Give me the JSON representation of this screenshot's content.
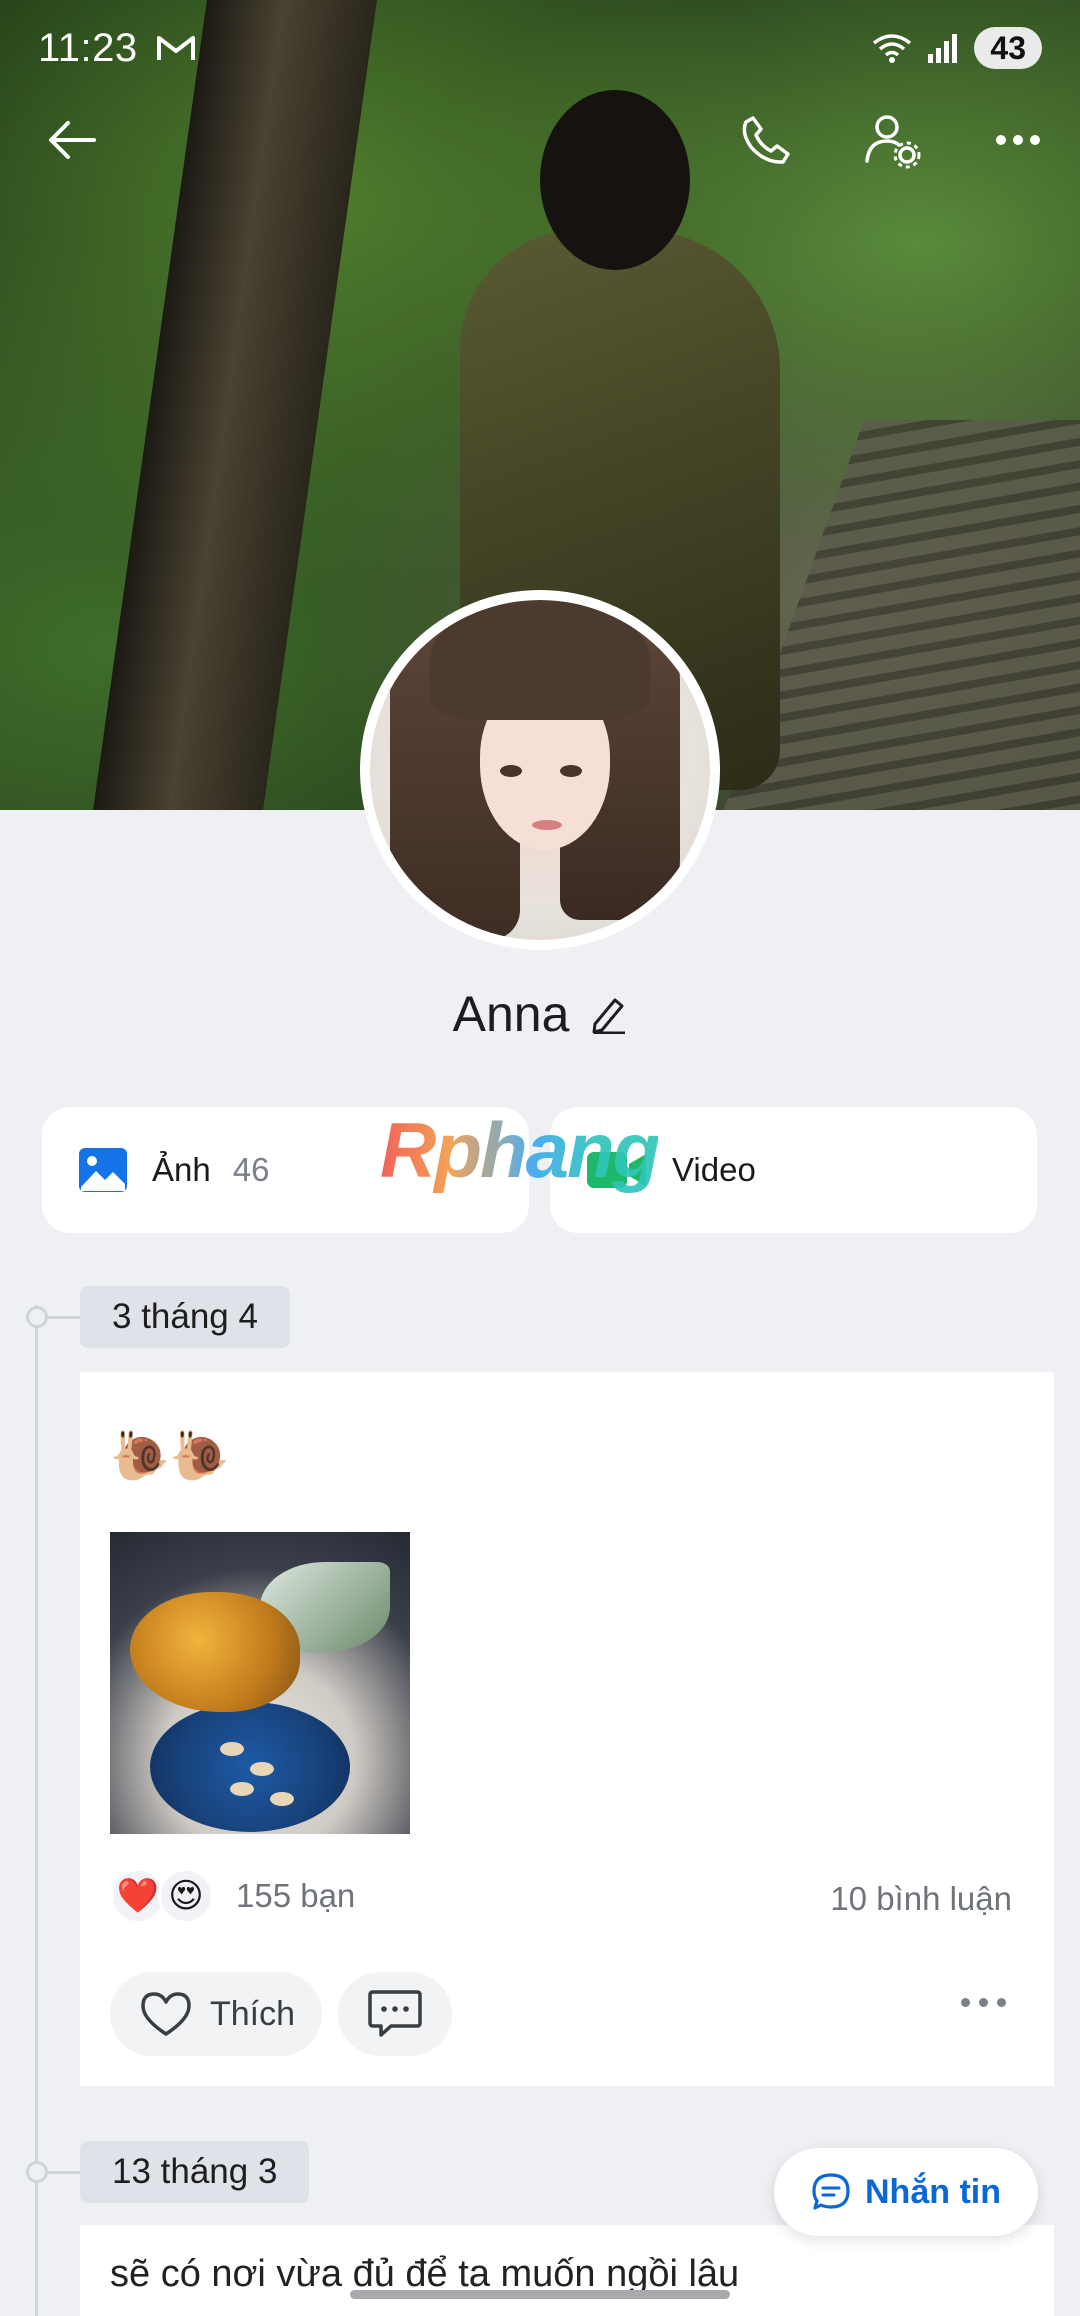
{
  "status_bar": {
    "time": "11:23",
    "battery": "43"
  },
  "profile": {
    "name": "Anna"
  },
  "media": {
    "photos": {
      "label": "Ảnh",
      "count": "46"
    },
    "videos": {
      "label": "Video"
    }
  },
  "watermark": "Rphang",
  "timeline": [
    {
      "date": "3 tháng 4",
      "text": "🐌🐌",
      "reactions": [
        "❤️",
        "😍"
      ],
      "likes_text": "155 bạn",
      "comments_text": "10 bình luận",
      "like_label": "Thích"
    },
    {
      "date": "13 tháng 3",
      "text": "sẽ có nơi vừa đủ để ta muốn ngồi lâu"
    }
  ],
  "message_button": {
    "label": "Nhắn tin"
  },
  "colors": {
    "accent": "#0a68d6",
    "background": "#eef0f4",
    "photo_icon": "#1473e6",
    "video_icon": "#1fb86a"
  }
}
